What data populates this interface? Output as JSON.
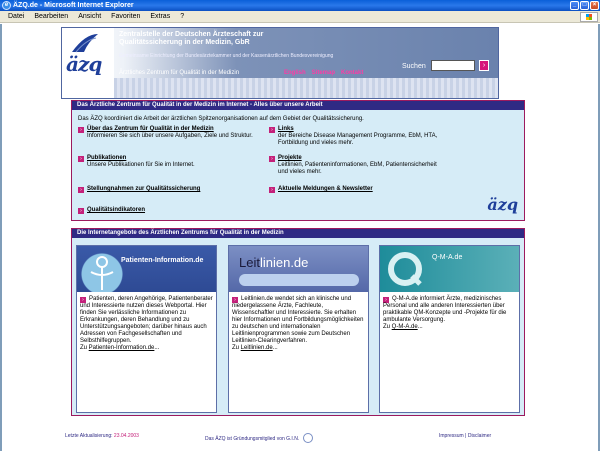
{
  "window": {
    "title": "ÄZQ.de - Microsoft Internet Explorer",
    "ie_icon": "ie-icon",
    "buttons": [
      "minimize-icon",
      "maximize-icon",
      "close-icon"
    ]
  },
  "menu": {
    "items": [
      "Datei",
      "Bearbeiten",
      "Ansicht",
      "Favoriten",
      "Extras",
      "?"
    ]
  },
  "header": {
    "logo": "äzq",
    "title_line1": "Zentralstelle der Deutschen Ärzteschaft zur",
    "title_line2": "Qualitätssicherung in der Medizin, GbR",
    "subtitle": "Gemeinsame Einrichtung der Bundesärztekammer und der Kassenärztlichen Bundesvereinigung",
    "zentrum": "Ärztliches Zentrum für Qualität in der Medizin",
    "links": [
      "English",
      "Sitemap",
      "Kontakt"
    ],
    "search_label": "Suchen",
    "search_value": "",
    "go_icon": "go-arrow-icon"
  },
  "box1": {
    "heading": "Das Ärztliche Zentrum für Qualität in der Medizin im Internet - Alles über unsere Arbeit",
    "intro": "Das ÄZQ koordiniert die Arbeit der ärztlichen Spitzenorganisationen auf dem Gebiet der Qualitätssicherung.",
    "items": [
      {
        "title": "Über das Zentrum für Qualität in der Medizin",
        "desc": "Informieren Sie sich über unsere Aufgaben, Ziele und Struktur."
      },
      {
        "title": "Links",
        "desc": "der Bereiche Disease Management Programme, EbM, HTA, Fortbildung und vieles mehr."
      },
      {
        "title": "Publikationen",
        "desc": "Unsere Publikationen für Sie im Internet."
      },
      {
        "title": "Projekte",
        "desc": "Leitlinien, Patienteninformationen, EbM, Patientensicherheit und vieles mehr."
      },
      {
        "title": "Stellungnahmen zur Qualitätssicherung",
        "desc": ""
      },
      {
        "title": "Aktuelle Meldungen & Newsletter",
        "desc": ""
      },
      {
        "title": "Qualitätsindikatoren",
        "desc": ""
      }
    ],
    "logo": "äzq"
  },
  "box2": {
    "heading": "Die Internetangebote des Ärztlichen Zentrums für Qualität in der Medizin",
    "cards": [
      {
        "banner": "Patienten-Information.de",
        "text": "Patienten, deren Angehörige, Patientenberater und Interessierte nutzen dieses Webportal. Hier finden Sie verlässliche Informationen zu Erkrankungen, deren Behandlung und zu Unterstützungsangeboten; darüber hinaus auch Adressen von Fachgesellschaften und Selbsthilfegruppen.",
        "link_prefix": "Zu ",
        "link": "Patienten-Information.de",
        "link_suffix": "..."
      },
      {
        "banner_a": "Leit",
        "banner_b": "linien.de",
        "text": "Leitlinien.de wendet sich an klinische und niedergelassene Ärzte, Fachleute, Wissenschaftler und Interessierte. Sie erhalten hier Informationen und Fortbildungsmöglichkeiten zu deutschen und internationalen Leitlinienprogrammen sowie zum Deutschen Leitlinien-Clearingverfahren.",
        "link_prefix": "Zu ",
        "link": "Leitlinien.de",
        "link_suffix": "..."
      },
      {
        "banner": "Q-M-A.de",
        "text": "Q-M-A.de informiert Ärzte, medizinisches Personal und alle anderen Interessierten über praktikable QM-Konzepte und -Projekte für die ambulante Versorgung.",
        "link_prefix": "Zu ",
        "link": "Q-M-A.de",
        "link_suffix": "..."
      }
    ]
  },
  "footer": {
    "updated_label": "Letzte Aktualisierung: ",
    "updated_date": "23.04.2003",
    "gin_text": "Das ÄZQ ist Gründungsmitglied von G.I.N.",
    "impressum": "Impressum",
    "separator": "|",
    "disclaimer": "Disclaimer"
  }
}
